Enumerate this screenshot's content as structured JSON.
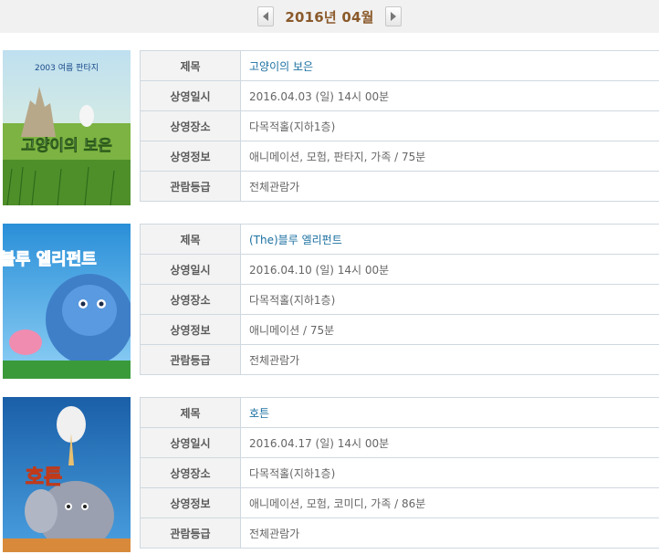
{
  "header": {
    "month_label": "2016년 04월"
  },
  "labels": {
    "title": "제목",
    "datetime": "상영일시",
    "venue": "상영장소",
    "info": "상영정보",
    "rating": "관람등급"
  },
  "colors": {
    "title_link": "#1a6fa0",
    "month_title": "#8a5a2b",
    "header_bg": "#f1f1f1",
    "label_bg": "#f3f3f3",
    "border": "#cfd8e0"
  },
  "movies": [
    {
      "title": "고양이의 보은",
      "datetime": "2016.04.03 (일) 14시 00분",
      "venue": "다목적홀(지하1층)",
      "info": "애니메이션, 모험, 판타지, 가족 / 75분",
      "rating": "전체관람가",
      "poster_text": "고양이의 보은",
      "poster_tagline": "2003 여름 판타지"
    },
    {
      "title": "(The)블루 엘리펀트",
      "datetime": "2016.04.10 (일) 14시 00분",
      "venue": "다목적홀(지하1층)",
      "info": "애니메이션 / 75분",
      "rating": "전체관람가",
      "poster_text": "블루 엘리펀트"
    },
    {
      "title": "호튼",
      "datetime": "2016.04.17 (일) 14시 00분",
      "venue": "다목적홀(지하1층)",
      "info": "애니메이션, 모험, 코미디, 가족 / 86분",
      "rating": "전체관람가",
      "poster_text": "호튼"
    }
  ]
}
